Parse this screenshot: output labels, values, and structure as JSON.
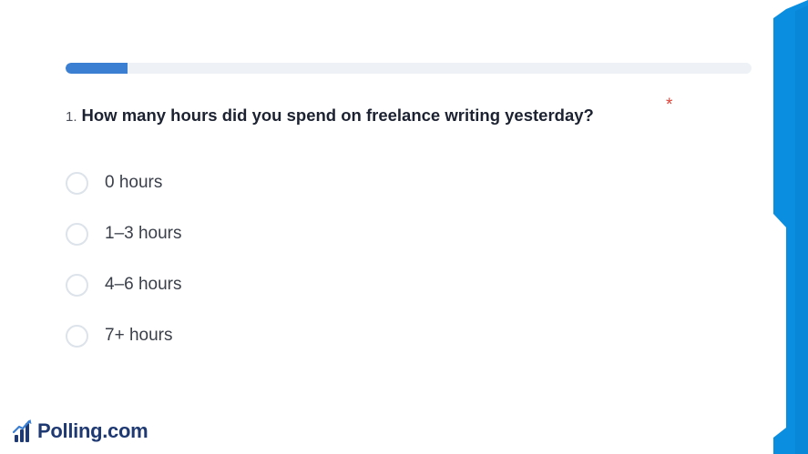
{
  "survey": {
    "progress_percent": 9,
    "question": {
      "number": "1.",
      "text": "How many hours did you spend on freelance writing yesterday?",
      "required_marker": "*"
    },
    "options": [
      {
        "label": "0 hours"
      },
      {
        "label": "1–3 hours"
      },
      {
        "label": "4–6 hours"
      },
      {
        "label": "7+ hours"
      }
    ]
  },
  "brand": {
    "name": "Polling.com",
    "icon": "bar-chart-logo-icon"
  },
  "colors": {
    "accent": "#3b7fd3",
    "banner": "#0a8ee0",
    "required": "#e0443a",
    "brand_text": "#1f3a73"
  }
}
